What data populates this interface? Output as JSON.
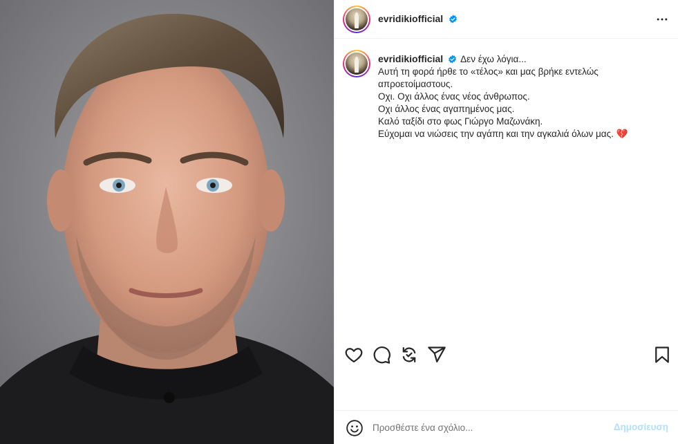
{
  "post": {
    "username": "evridikiofficial",
    "verified": true,
    "caption_title": "Δεν έχω λόγια...",
    "caption_lines": [
      "Αυτή τη φορά ήρθε το «τέλος» και μας βρήκε εντελώς απροετοίμαστους.",
      "Οχι. Οχι άλλος ένας νέος άνθρωπος.",
      "Οχι άλλος ένας αγαπημένος μας.",
      "Καλό ταξίδι στο φως Γιώργο Μαζωνάκη.",
      "Εύχομαι να νιώσεις την αγάπη και την αγκαλιά όλων μας. 💔"
    ]
  },
  "comment": {
    "placeholder": "Προσθέστε ένα σχόλιο...",
    "post_label": "Δημοσίευση"
  },
  "colors": {
    "verified_blue": "#0095f6",
    "post_button_disabled": "#b2dffc",
    "text": "#262626"
  },
  "icons": {
    "more": "more-horizontal-icon",
    "like": "heart-icon",
    "comment": "comment-bubble-icon",
    "repost": "repost-icon",
    "share": "send-paper-plane-icon",
    "save": "bookmark-icon",
    "emoji": "smiley-emoji-icon"
  }
}
